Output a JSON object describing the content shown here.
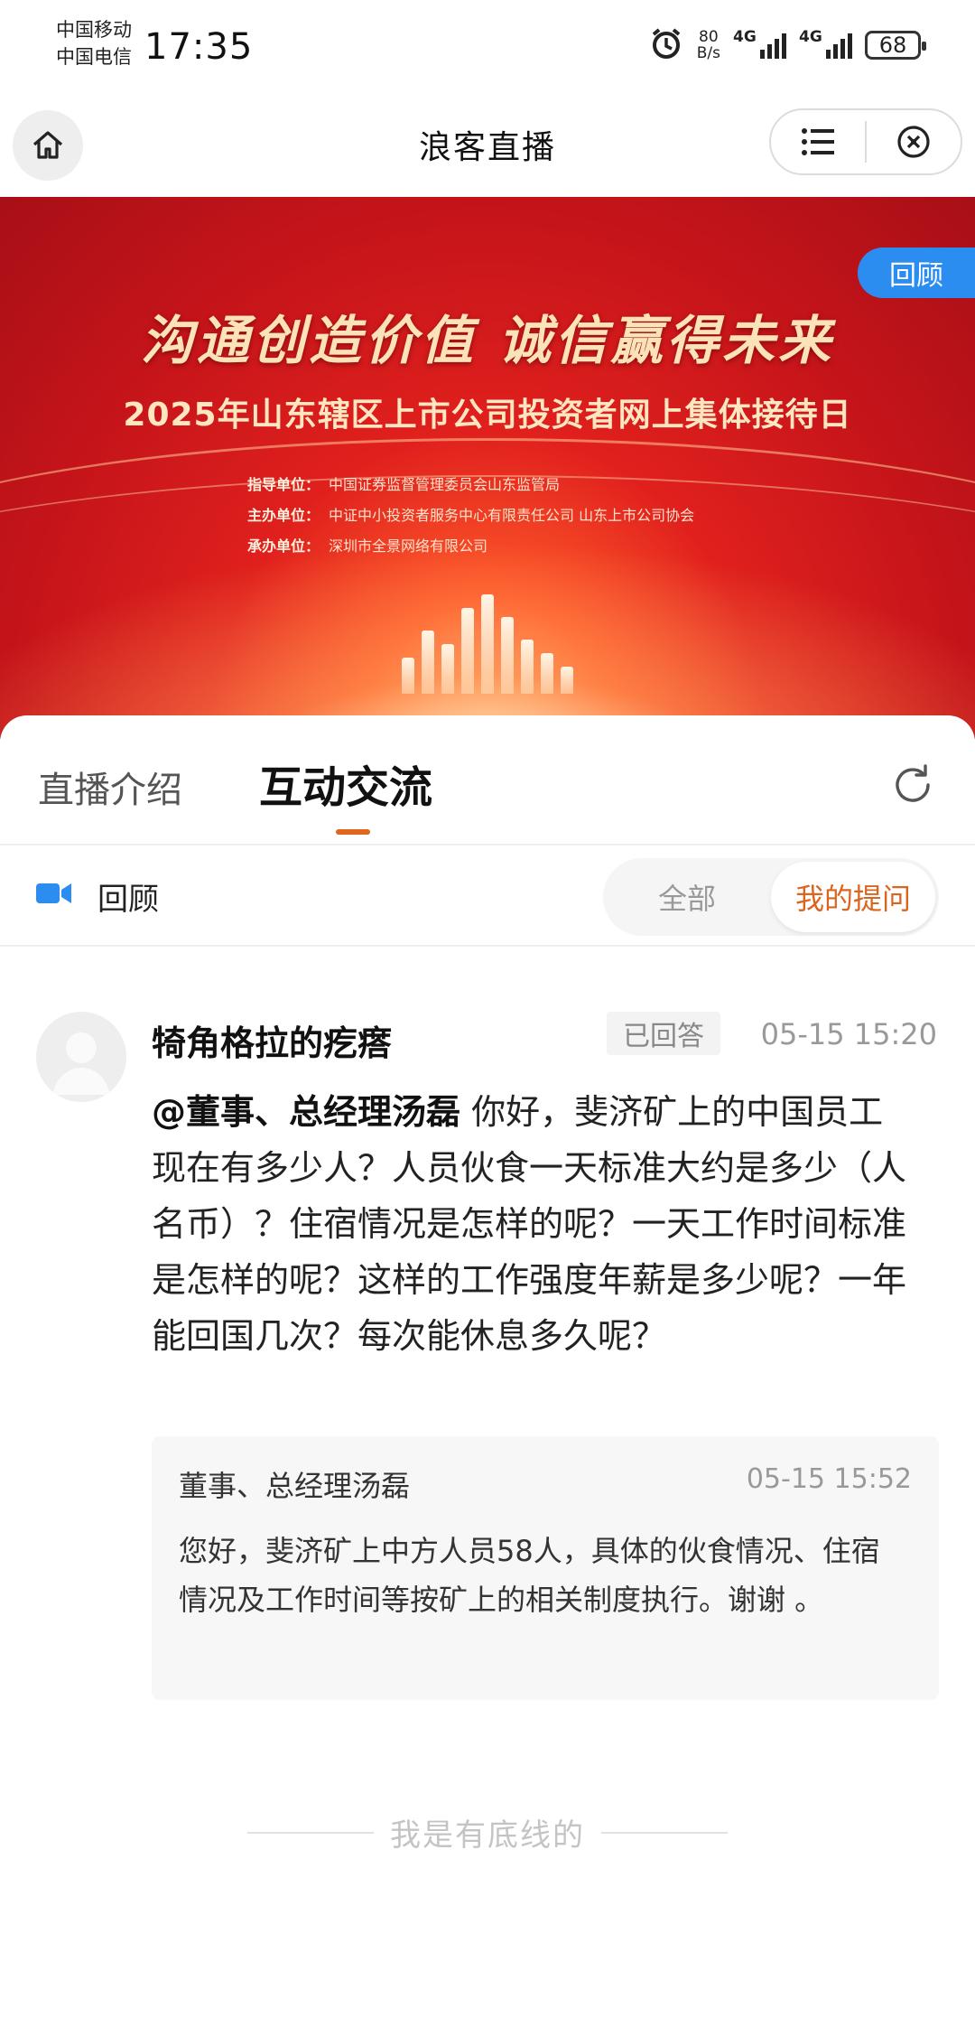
{
  "status_bar": {
    "carrier1": "中国移动",
    "carrier2": "中国电信",
    "time": "17:35",
    "net_speed_value": "80",
    "net_speed_unit": "B/s",
    "signal1": "4G",
    "signal2": "4G",
    "battery": "68"
  },
  "nav": {
    "title": "浪客直播"
  },
  "banner": {
    "slogan": "沟通创造价值  诚信赢得未来",
    "title": "2025年山东辖区上市公司投资者网上集体接待日",
    "lines": [
      {
        "label": "指导单位：",
        "value": "中国证券监督管理委员会山东监管局"
      },
      {
        "label": "主办单位：",
        "value": "中证中小投资者服务中心有限责任公司  山东上市公司协会"
      },
      {
        "label": "承办单位：",
        "value": "深圳市全景网络有限公司"
      }
    ],
    "tag": "回顾"
  },
  "tabs": {
    "intro": "直播介绍",
    "interact": "互动交流"
  },
  "filter": {
    "replay_label": "回顾",
    "all": "全部",
    "mine": "我的提问"
  },
  "question": {
    "username": "犄角格拉的疙瘩",
    "status": "已回答",
    "time": "05-15 15:20",
    "mention": "@董事、总经理汤磊",
    "text": " 你好，斐济矿上的中国员工现在有多少人？人员伙食一天标准大约是多少（人名币）？住宿情况是怎样的呢？一天工作时间标准是怎样的呢？这样的工作强度年薪是多少呢？一年能回国几次？每次能休息多久呢？"
  },
  "answer": {
    "name": "董事、总经理汤磊",
    "time": "05-15 15:52",
    "text": "您好，斐济矿上中方人员58人，具体的伙食情况、住宿情况及工作时间等按矿上的相关制度执行。谢谢 。"
  },
  "footer": {
    "bottom_text": "我是有底线的"
  },
  "colors": {
    "accent": "#e0661e",
    "replay_tag": "#2b8df0",
    "banner_red": "#c4141a"
  }
}
